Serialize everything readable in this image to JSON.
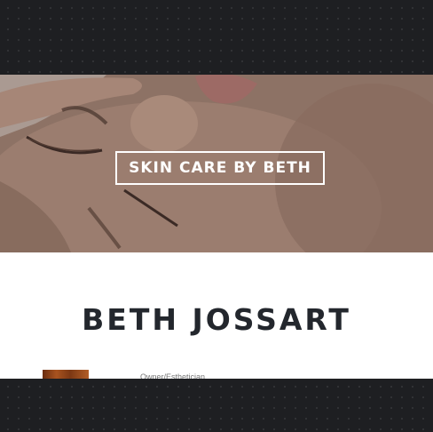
{
  "hero": {
    "title": "SKIN CARE BY BETH"
  },
  "profile": {
    "name": "BETH JOSSART",
    "role": "Owner/Esthetician"
  },
  "colors": {
    "dark_band": "#1e1f22",
    "heading": "#23272d",
    "hero_tone": "#a9897a"
  }
}
